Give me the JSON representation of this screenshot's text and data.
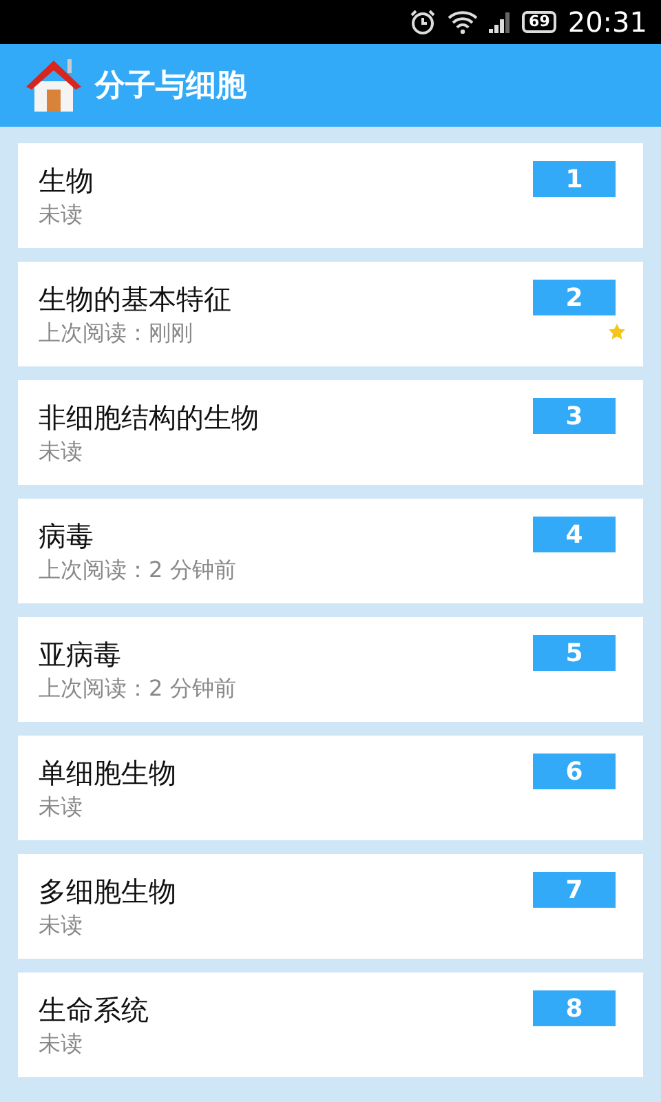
{
  "status_bar": {
    "battery": "69",
    "time": "20:31"
  },
  "header": {
    "title": "分子与细胞"
  },
  "items": [
    {
      "title": "生物",
      "subtitle": "未读",
      "number": "1",
      "starred": false
    },
    {
      "title": "生物的基本特征",
      "subtitle": "上次阅读：刚刚",
      "number": "2",
      "starred": true
    },
    {
      "title": "非细胞结构的生物",
      "subtitle": "未读",
      "number": "3",
      "starred": false
    },
    {
      "title": "病毒",
      "subtitle": "上次阅读：2 分钟前",
      "number": "4",
      "starred": false
    },
    {
      "title": "亚病毒",
      "subtitle": "上次阅读：2 分钟前",
      "number": "5",
      "starred": false
    },
    {
      "title": "单细胞生物",
      "subtitle": "未读",
      "number": "6",
      "starred": false
    },
    {
      "title": "多细胞生物",
      "subtitle": "未读",
      "number": "7",
      "starred": false
    },
    {
      "title": "生命系统",
      "subtitle": "未读",
      "number": "8",
      "starred": false
    }
  ]
}
